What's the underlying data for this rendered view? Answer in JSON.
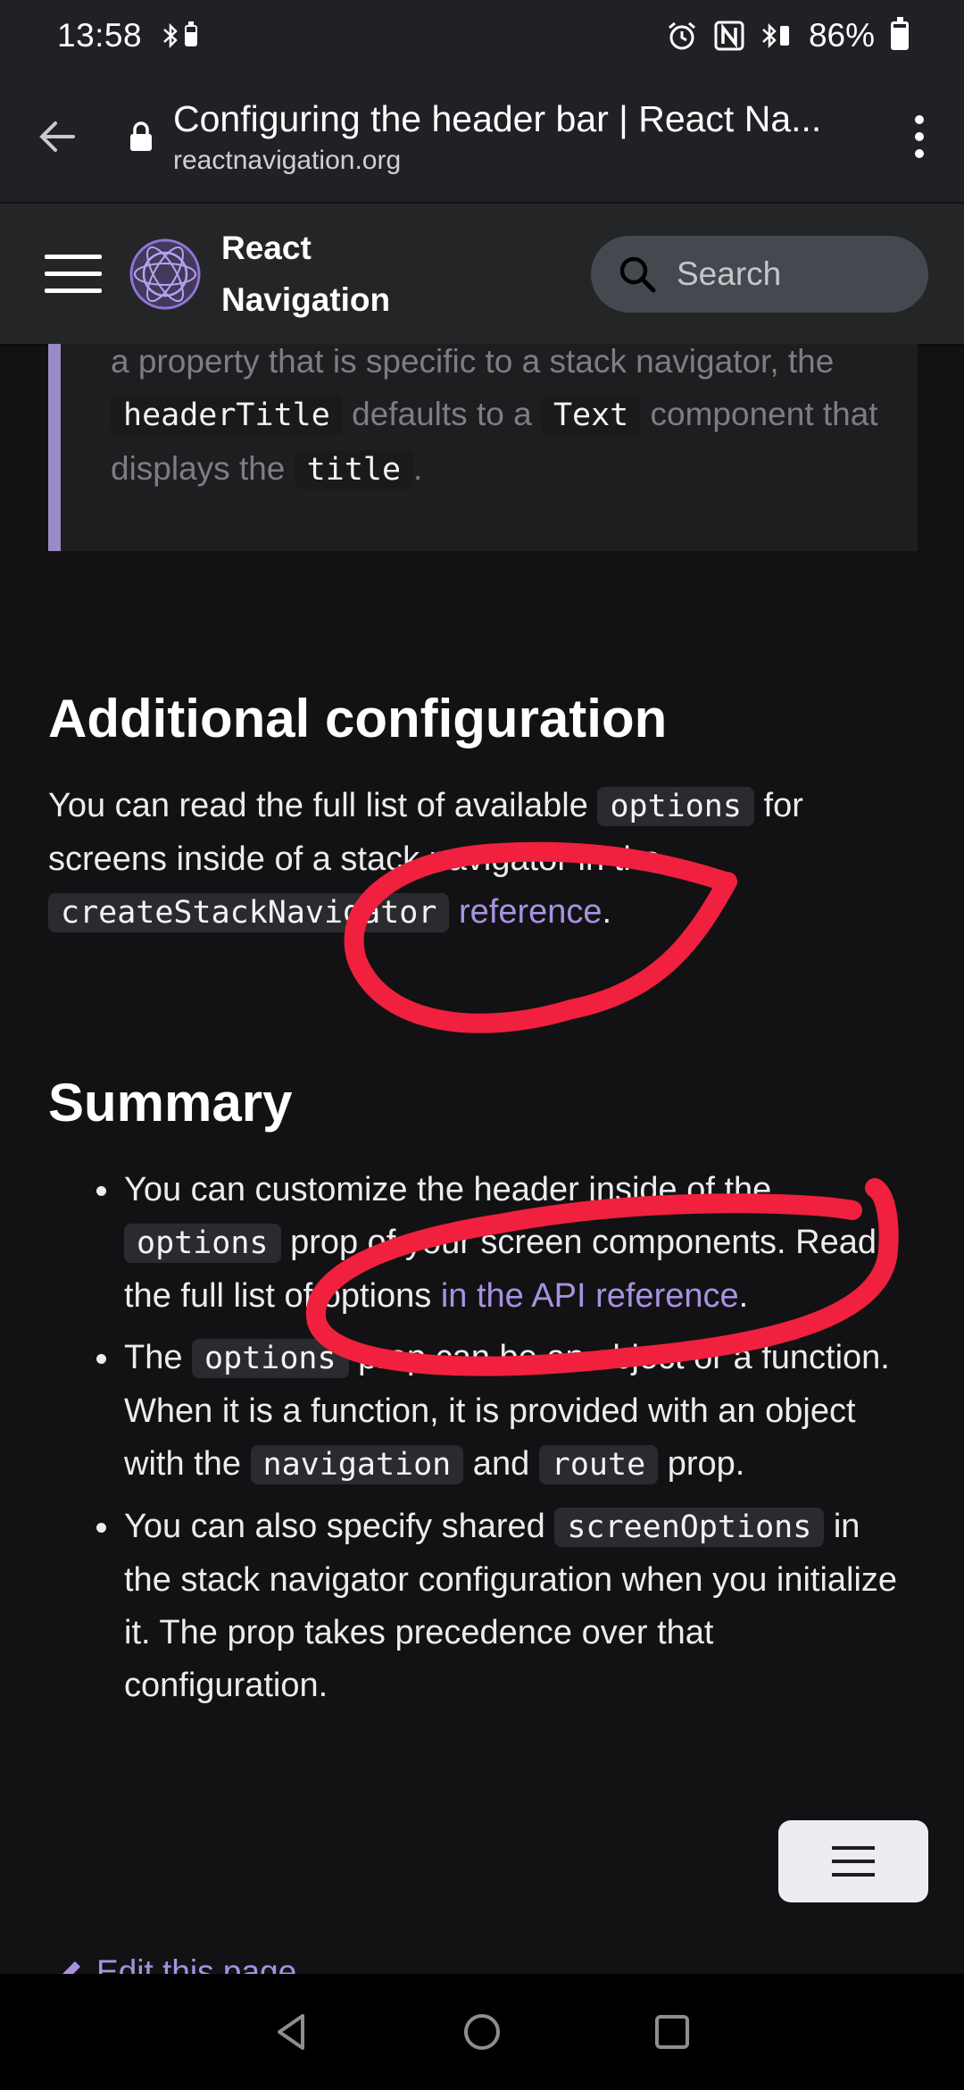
{
  "status_bar": {
    "time": "13:58",
    "battery_percent": "86%",
    "battery_level": 0.86
  },
  "browser": {
    "page_title": "Configuring the header bar | React Na...",
    "domain": "reactnavigation.org"
  },
  "site_nav": {
    "brand_line1": "React",
    "brand_line2": "Navigation",
    "search_placeholder": "Search"
  },
  "callout": {
    "t1": "a property that is specific to a stack navigator, the ",
    "code1": "headerTitle",
    "t2": " defaults to a ",
    "code2": "Text",
    "t3": " component that displays the ",
    "code3": "title",
    "t4": "."
  },
  "additional": {
    "heading": "Additional configuration",
    "t1": "You can read the full list of available ",
    "code1": "options",
    "t2": " for screens inside of a stack navigator in the ",
    "code2": "createStackNavigator",
    "t3": " ",
    "link": "reference",
    "t4": "."
  },
  "summary": {
    "heading": "Summary",
    "b1": {
      "t1": "You can customize the header inside of the ",
      "code1": "options",
      "t2": " prop of your screen components. Read the full list of options ",
      "link": "in the API reference",
      "t3": "."
    },
    "b2": {
      "t1": "The ",
      "code1": "options",
      "t2": " prop can be an object or a function. When it is a function, it is provided with an object with the ",
      "code2": "navigation",
      "t3": " and ",
      "code3": "route",
      "t4": " prop."
    },
    "b3": {
      "t1": "You can also specify shared ",
      "code1": "screenOptions",
      "t2": " in the stack navigator configuration when you initialize it. The prop takes precedence over that configuration."
    }
  },
  "footer": {
    "edit_link": "Edit this page"
  },
  "colors": {
    "accent": "#a892e0",
    "callout_border": "#9a8ac7",
    "annotation": "#f0203e",
    "page_background": "#121214"
  }
}
